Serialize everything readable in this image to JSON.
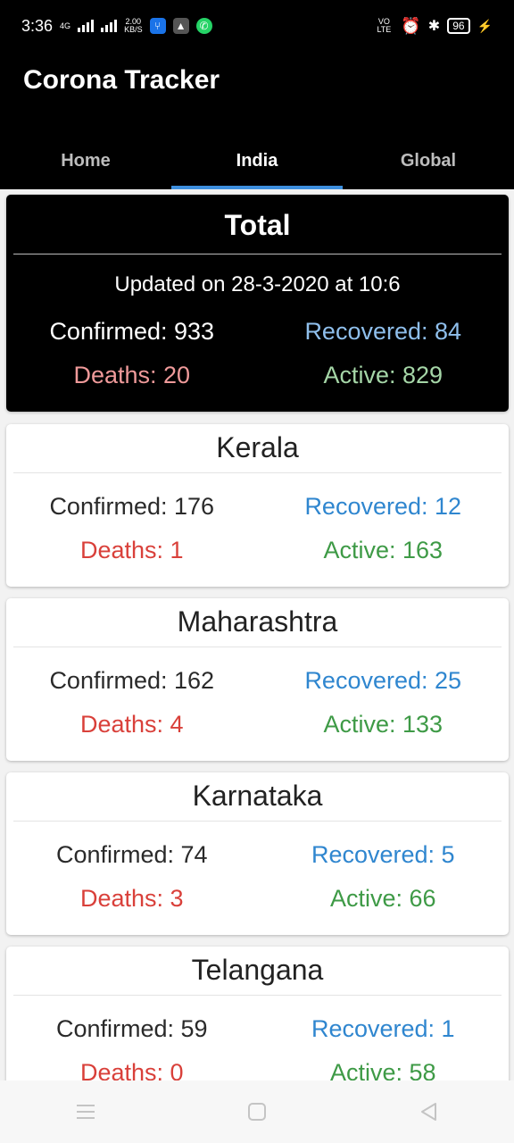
{
  "status_bar": {
    "time": "3:36",
    "net_speed_value": "2.00",
    "net_speed_unit": "KB/S",
    "network_label": "4G",
    "volte_label": "VO LTE",
    "battery": "96"
  },
  "app": {
    "title": "Corona Tracker"
  },
  "tabs": [
    {
      "label": "Home"
    },
    {
      "label": "India"
    },
    {
      "label": "Global"
    }
  ],
  "total": {
    "title": "Total",
    "updated": "Updated on 28-3-2020 at 10:6",
    "confirmed": "Confirmed: 933",
    "recovered": "Recovered: 84",
    "deaths": "Deaths: 20",
    "active": "Active: 829"
  },
  "states": [
    {
      "name": "Kerala",
      "confirmed": "Confirmed: 176",
      "recovered": "Recovered: 12",
      "deaths": "Deaths: 1",
      "active": "Active: 163"
    },
    {
      "name": "Maharashtra",
      "confirmed": "Confirmed: 162",
      "recovered": "Recovered: 25",
      "deaths": "Deaths: 4",
      "active": "Active: 133"
    },
    {
      "name": "Karnataka",
      "confirmed": "Confirmed: 74",
      "recovered": "Recovered: 5",
      "deaths": "Deaths: 3",
      "active": "Active: 66"
    },
    {
      "name": "Telangana",
      "confirmed": "Confirmed: 59",
      "recovered": "Recovered: 1",
      "deaths": "Deaths: 0",
      "active": "Active: 58"
    }
  ],
  "colors": {
    "accent": "#3d8fde",
    "recovered": "#2f86cf",
    "deaths": "#d9403a",
    "active": "#3e9a46"
  },
  "icons": [
    "usb-icon",
    "drive-icon",
    "whatsapp-icon",
    "alarm-icon",
    "bluetooth-icon",
    "battery-icon",
    "charging-icon",
    "menu-icon",
    "home-icon",
    "back-icon"
  ]
}
